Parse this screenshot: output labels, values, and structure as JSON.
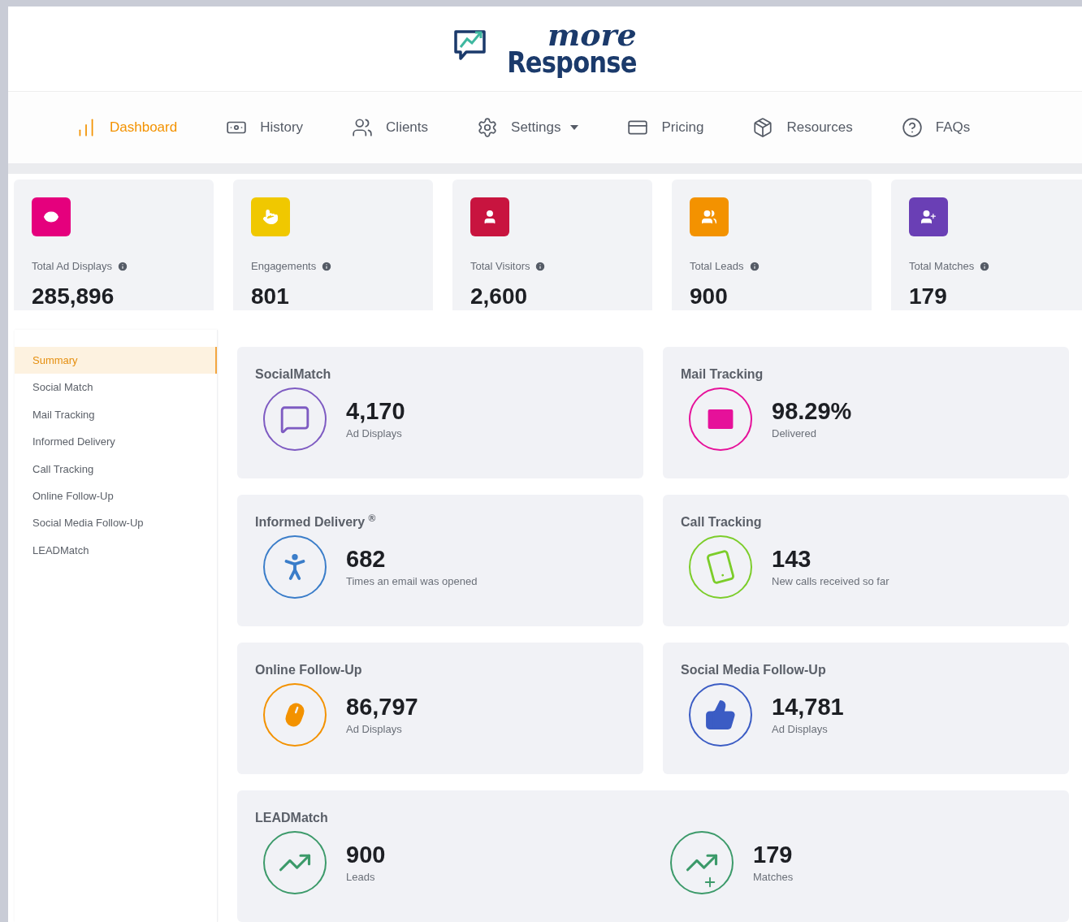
{
  "logo": {
    "word_1": "more",
    "word_2": "Response"
  },
  "nav": [
    {
      "label": "Dashboard",
      "kind": "bars",
      "selected": true,
      "dropdown": false
    },
    {
      "label": "History",
      "kind": "banknote",
      "selected": false,
      "dropdown": false
    },
    {
      "label": "Clients",
      "kind": "users",
      "selected": false,
      "dropdown": false
    },
    {
      "label": "Settings",
      "kind": "gear",
      "selected": false,
      "dropdown": true
    },
    {
      "label": "Pricing",
      "kind": "card",
      "selected": false,
      "dropdown": false
    },
    {
      "label": "Resources",
      "kind": "package",
      "selected": false,
      "dropdown": false
    },
    {
      "label": "FAQs",
      "kind": "help",
      "selected": false,
      "dropdown": false
    }
  ],
  "stats": [
    {
      "label": "Total Ad Displays",
      "value": "285,896",
      "kind": "eye",
      "color": "#e5007d"
    },
    {
      "label": "Engagements",
      "value": "801",
      "kind": "pointer",
      "color": "#f0c800"
    },
    {
      "label": "Total Visitors",
      "value": "2,600",
      "kind": "user",
      "color": "#c8143f"
    },
    {
      "label": "Total Leads",
      "value": "900",
      "kind": "users",
      "color": "#f39200"
    },
    {
      "label": "Total Matches",
      "value": "179",
      "kind": "user-plus",
      "color": "#6a3fb5"
    }
  ],
  "sidebar": {
    "items": [
      {
        "label": "Summary",
        "selected": true
      },
      {
        "label": "Social Match",
        "selected": false
      },
      {
        "label": "Mail Tracking",
        "selected": false
      },
      {
        "label": "Informed Delivery",
        "selected": false
      },
      {
        "label": "Call Tracking",
        "selected": false
      },
      {
        "label": "Online Follow-Up",
        "selected": false
      },
      {
        "label": "Social Media Follow-Up",
        "selected": false
      },
      {
        "label": "LEADMatch",
        "selected": false
      }
    ]
  },
  "panels": [
    {
      "title": "SocialMatch",
      "metrics": [
        {
          "kind": "mail-chat",
          "color": "#7e5bc2",
          "value": "4,170",
          "caption": "Ad Displays"
        }
      ]
    },
    {
      "title": "Mail Tracking",
      "metrics": [
        {
          "kind": "envelope",
          "color": "#e6119a",
          "value": "98.29%",
          "caption": "Delivered"
        }
      ]
    },
    {
      "title": "Informed Delivery $^{®}$",
      "metrics": [
        {
          "kind": "runner",
          "color": "#3a7dc9",
          "value": "682",
          "caption": "Times an email was opened"
        }
      ]
    },
    {
      "title": "Call Tracking",
      "metrics": [
        {
          "kind": "phone",
          "color": "#7ccd2a",
          "value": "143",
          "caption": "New calls received so far"
        }
      ]
    },
    {
      "title": "Online Follow-Up",
      "metrics": [
        {
          "kind": "mouse",
          "color": "#f39200",
          "value": "86,797",
          "caption": "Ad Displays"
        }
      ]
    },
    {
      "title": "Social Media Follow-Up",
      "metrics": [
        {
          "kind": "thumbs-up",
          "color": "#3b5cc4",
          "value": "14,781",
          "caption": "Ad Displays"
        }
      ]
    },
    {
      "title": "LEADMatch",
      "metrics": [
        {
          "kind": "trend",
          "color": "#3c9a6a",
          "value": "900",
          "caption": "Leads"
        },
        {
          "kind": "trend-plus",
          "color": "#3c9a6a",
          "value": "179",
          "caption": "Matches"
        }
      ]
    }
  ]
}
